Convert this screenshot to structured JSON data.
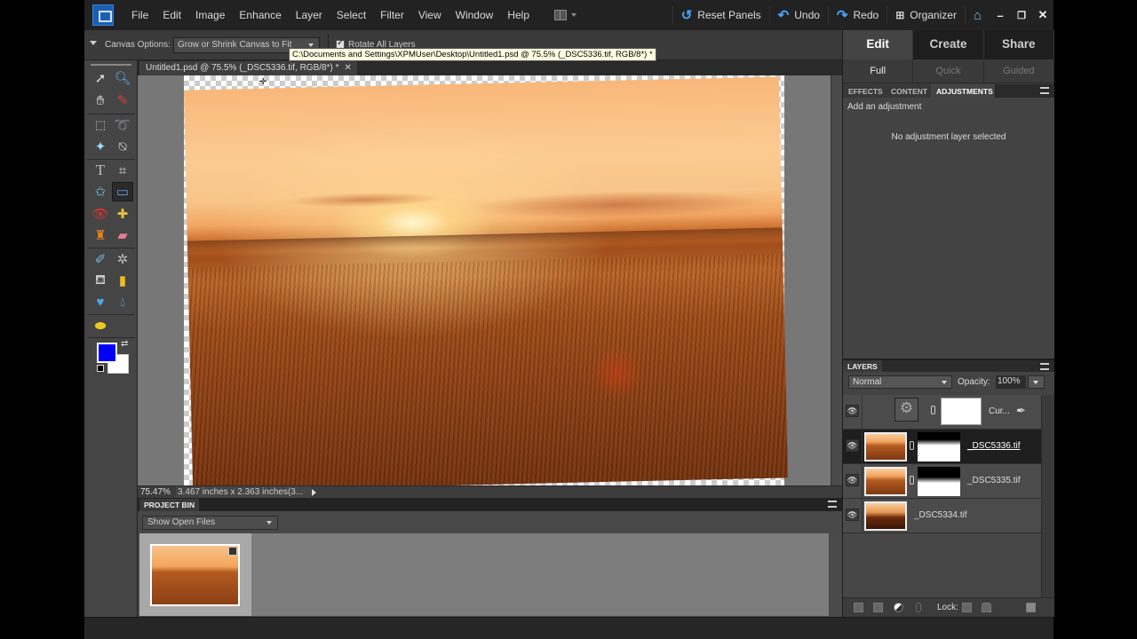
{
  "menubar": {
    "items": [
      "File",
      "Edit",
      "Image",
      "Enhance",
      "Layer",
      "Select",
      "Filter",
      "View",
      "Window",
      "Help"
    ],
    "reset_panels": "Reset Panels",
    "undo": "Undo",
    "redo": "Redo",
    "organizer": "Organizer",
    "window_controls": {
      "minimize": "–",
      "restore": "❐",
      "close": "✕"
    }
  },
  "options_bar": {
    "canvas_options_label": "Canvas Options:",
    "canvas_options_value": "Grow or Shrink Canvas to Fit",
    "rotate_all_layers_label": "Rotate All Layers",
    "rotate_all_layers_checked": true
  },
  "tooltip": "C:\\Documents and Settings\\XPMUser\\Desktop\\Untitled1.psd @ 75.5% (_DSC5336.tif, RGB/8*) *",
  "document": {
    "tab_title": "Untitled1.psd @ 75.5% (_DSC5336.tif, RGB/8*) *",
    "close_glyph": "✕"
  },
  "status": {
    "zoom": "75.47%",
    "doc_info": "3.467 inches x 2.363 inches(3..."
  },
  "tools": {
    "foreground_color": "#0000ff",
    "background_color": "#ffffff"
  },
  "project_bin": {
    "title": "PROJECT BIN",
    "show_select": "Show Open Files"
  },
  "right_panel": {
    "modes": [
      "Edit",
      "Create",
      "Share"
    ],
    "active_mode": "Edit",
    "submodes": [
      "Full",
      "Quick",
      "Guided"
    ],
    "active_submode": "Full",
    "panel_tabs": [
      "EFFECTS",
      "CONTENT",
      "ADJUSTMENTS"
    ],
    "active_panel_tab": "ADJUSTMENTS",
    "add_adjustment": "Add an adjustment",
    "no_adjustment": "No adjustment layer selected"
  },
  "layers": {
    "title": "LAYERS",
    "blend_mode": "Normal",
    "opacity_label": "Opacity:",
    "opacity_value": "100%",
    "lock_label": "Lock:",
    "items": [
      {
        "name": "Cur...",
        "type": "adjustment",
        "visible": true,
        "selected": false
      },
      {
        "name": "_DSC5336.tif",
        "type": "image-with-mask",
        "visible": true,
        "selected": true
      },
      {
        "name": "_DSC5335.tif",
        "type": "image-with-mask",
        "visible": true,
        "selected": false
      },
      {
        "name": "_DSC5334.tif",
        "type": "image",
        "visible": true,
        "selected": false
      }
    ]
  }
}
